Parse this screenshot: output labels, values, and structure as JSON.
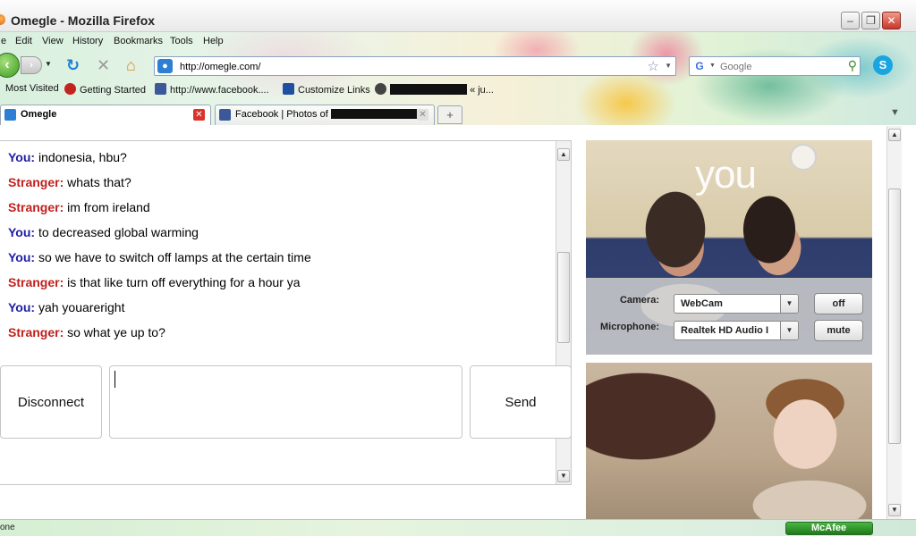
{
  "window": {
    "title": "Omegle - Mozilla Firefox"
  },
  "menu": [
    "e",
    "Edit",
    "View",
    "History",
    "Bookmarks",
    "Tools",
    "Help"
  ],
  "nav": {
    "url": "http://omegle.com/",
    "search_placeholder": "Google"
  },
  "bookmarks": [
    "Most Visited",
    "Getting Started",
    "http://www.facebook....",
    "Customize Links",
    "« ju..."
  ],
  "tabs": [
    {
      "title": "Omegle",
      "active": true
    },
    {
      "title": "Facebook | Photos of",
      "active": false
    }
  ],
  "chat": {
    "messages": [
      {
        "who": "You:",
        "text": "indonesia, hbu?"
      },
      {
        "who": "Stranger:",
        "text": "whats that?"
      },
      {
        "who": "Stranger:",
        "text": "im from ireland"
      },
      {
        "who": "You:",
        "text": "to decreased global warming"
      },
      {
        "who": "You:",
        "text": "so we have to switch off lamps at the certain time"
      },
      {
        "who": "Stranger:",
        "text": "is that like turn off everything for a hour ya"
      },
      {
        "who": "You:",
        "text": "yah youareright"
      },
      {
        "who": "Stranger:",
        "text": "so what ye up to?"
      }
    ],
    "disconnect_label": "Disconnect",
    "send_label": "Send",
    "input_value": ""
  },
  "video": {
    "you_label": "you",
    "camera_label": "Camera:",
    "camera_value": "WebCam",
    "camera_button": "off",
    "microphone_label": "Microphone:",
    "microphone_value": "Realtek HD Audio I",
    "microphone_button": "mute"
  },
  "status": {
    "text": "one",
    "mcafee": "McAfee"
  },
  "colors": {
    "you": "#1d1ca5",
    "stranger": "#c11f1c"
  }
}
